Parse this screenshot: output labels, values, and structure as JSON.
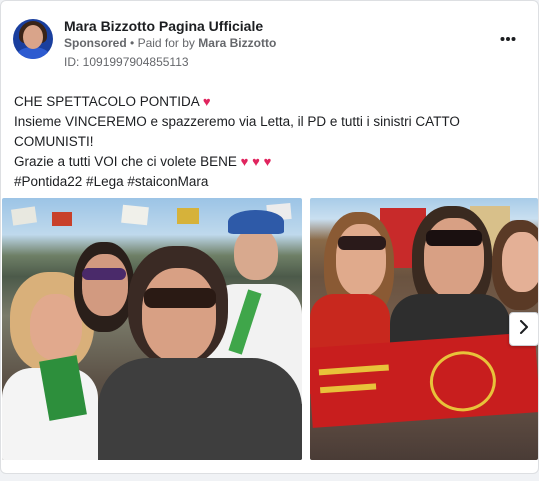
{
  "post": {
    "page_name": "Mara Bizzotto Pagina Ufficiale",
    "sponsored": "Sponsored",
    "separator": "•",
    "paid_for_prefix": "Paid for by",
    "paid_for_name": "Mara Bizzotto",
    "ad_id": "ID: 1091997904855113",
    "more_icon": "more-options-icon"
  },
  "body": {
    "line1": "CHE SPETTACOLO PONTIDA",
    "line2": "Insieme VINCEREMO e spazzeremo via Letta, il PD e tutti i sinistri CATTO COMUNISTI!",
    "line3": "Grazie a tutti VOI che ci volete BENE",
    "line4": "#Pontida22 #Lega #staiconMara",
    "heart_glyph": "♥"
  },
  "carousel": {
    "next_icon": "chevron-right-icon"
  },
  "colors": {
    "heart": "#e0245e",
    "text": "#1c1e21",
    "secondary_text": "#65676b"
  }
}
